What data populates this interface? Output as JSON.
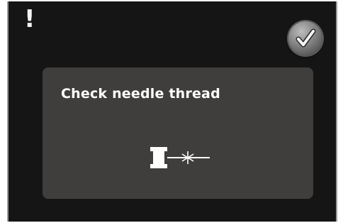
{
  "header": {
    "alert_symbol": "!",
    "alert_icon": "exclamation-icon",
    "confirm_icon": "checkmark-icon"
  },
  "dialog": {
    "message": "Check needle thread",
    "illustration_icon": "needle-thread-spool-icon"
  },
  "colors": {
    "screen_background": "#151515",
    "dialog_background": "#3f3e3c",
    "text": "#ffffff",
    "button_gray": "#7c7c7c"
  }
}
